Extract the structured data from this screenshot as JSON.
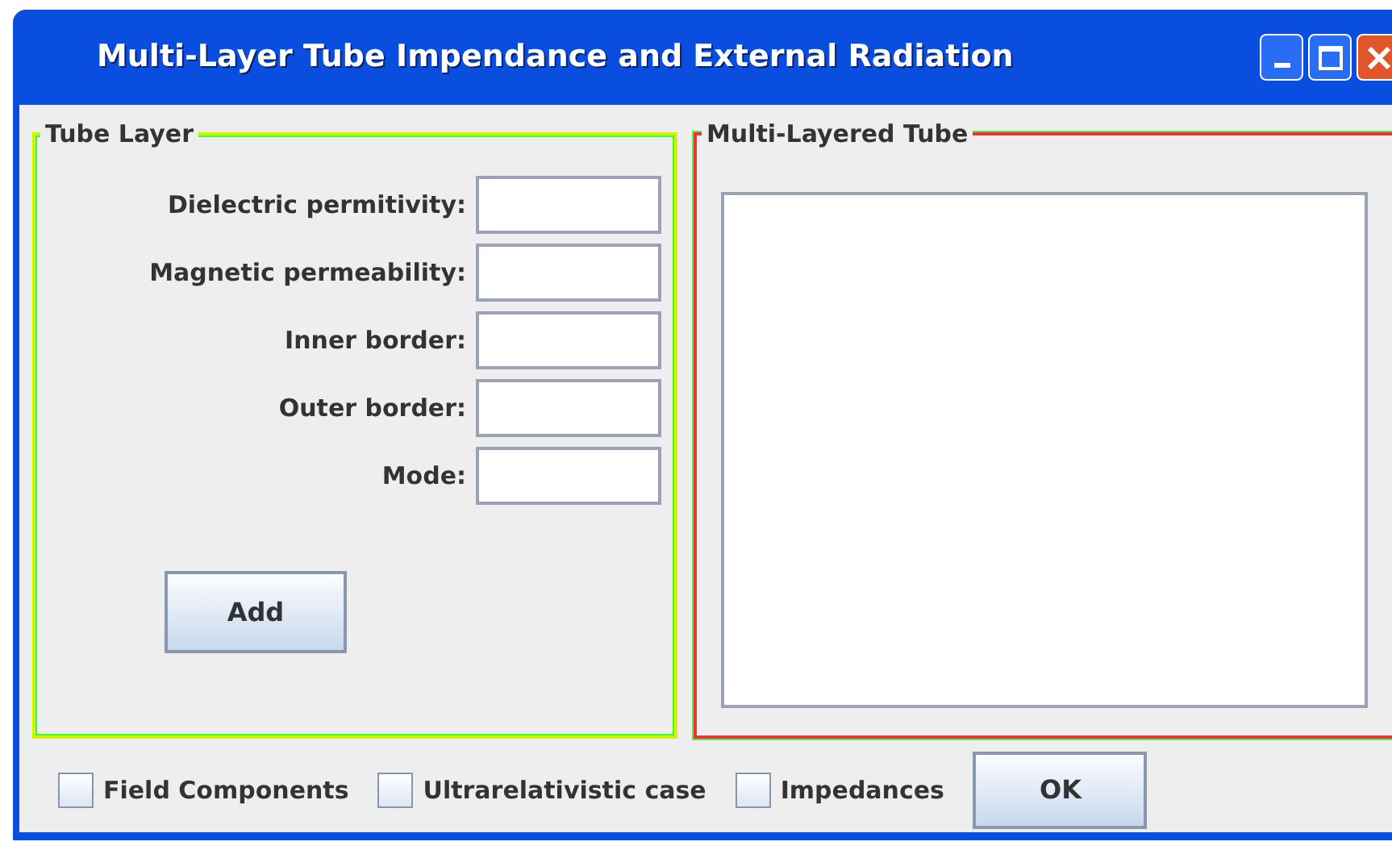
{
  "window": {
    "title": "Multi-Layer Tube Impendance and External Radiation"
  },
  "tube_layer": {
    "title": "Tube Layer",
    "fields": [
      {
        "label": "Dielectric permitivity:"
      },
      {
        "label": "Magnetic permeability:"
      },
      {
        "label": "Inner border:"
      },
      {
        "label": "Outer border:"
      },
      {
        "label": "Mode:"
      }
    ],
    "button": "Add"
  },
  "multi_layered_tube": {
    "title": "Multi-Layered Tube"
  },
  "options": [
    {
      "label": "Field Components",
      "checked": false
    },
    {
      "label": "Ultrarelativistic case",
      "checked": false
    },
    {
      "label": "Impedances",
      "checked": false
    }
  ],
  "ok_button": "OK"
}
